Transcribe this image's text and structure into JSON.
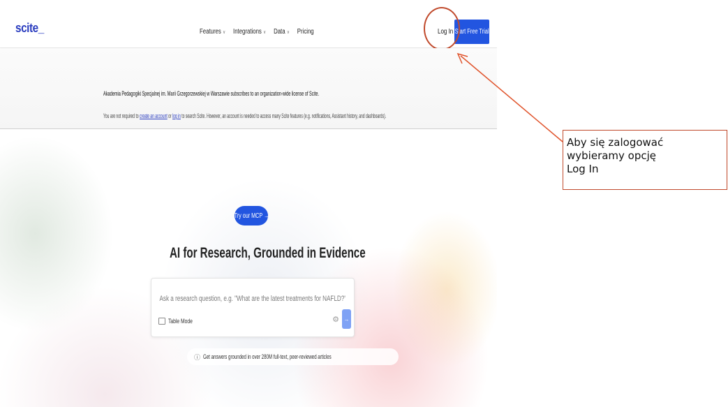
{
  "navbar": {
    "logo": "scite_",
    "links": [
      {
        "label": "Features",
        "has_dropdown": true
      },
      {
        "label": "Integrations",
        "has_dropdown": true
      },
      {
        "label": "Data",
        "has_dropdown": true
      },
      {
        "label": "Pricing",
        "has_dropdown": false
      }
    ],
    "login_label": "Log In",
    "trial_label": "Start Free Trial",
    "accent_color": "#2255e0"
  },
  "notice": {
    "line1": "Akademia Pedagogiki Specjalnej im. Marii Grzegorzewskiej w Warszawie subscribes to an organization-wide license of Scite.",
    "line2_prefix": "You are not required to ",
    "create_account_link": "create an account",
    "line2_or": " or ",
    "login_link": "log in",
    "line2_suffix": " to search Scite. However, an account is needed to access many Scite features (e.g. notifications, Assistant history, and dashboards)."
  },
  "hero": {
    "mcp_button": "Try our MCP →",
    "title": "AI for Research, Grounded in Evidence",
    "search_placeholder": "Ask a research question, e.g. \"What are the latest treatments for NAFLD?\"",
    "table_mode_label": "Table Mode",
    "grounded_text": "Get answers grounded in over 280M full-text, peer-reviewed articles"
  },
  "annotation": {
    "line1": "Aby się zalogować",
    "line2": "wybieramy opcję",
    "line3": "Log In",
    "color": "#c0492b"
  }
}
